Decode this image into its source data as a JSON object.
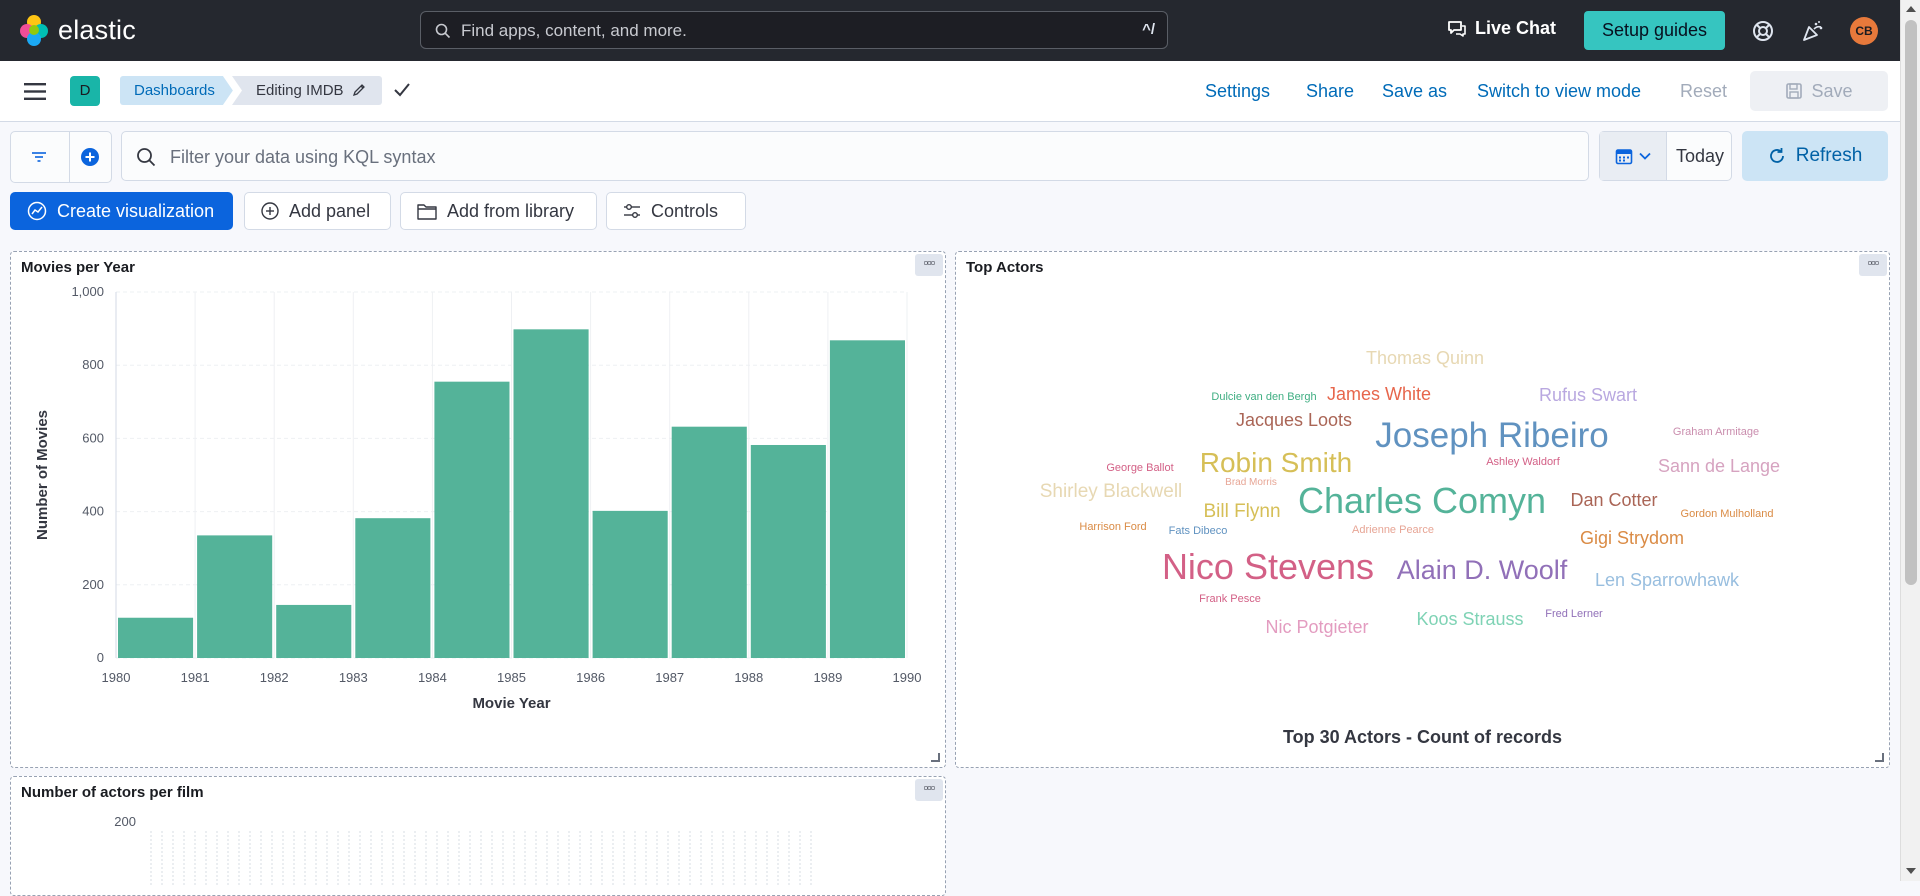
{
  "topbar": {
    "brand": "elastic",
    "search_placeholder": "Find apps, content, and more.",
    "search_shortcut": "^/",
    "live_chat": "Live Chat",
    "setup_guides": "Setup guides",
    "avatar_initials": "CB"
  },
  "navbar": {
    "space_initial": "D",
    "breadcrumbs": [
      "Dashboards",
      "Editing IMDB"
    ],
    "links": [
      "Settings",
      "Share",
      "Save as",
      "Switch to view mode"
    ],
    "reset": "Reset",
    "save": "Save"
  },
  "filterbar": {
    "kql_placeholder": "Filter your data using KQL syntax",
    "date": "Today",
    "refresh": "Refresh"
  },
  "actions": {
    "create_visualization": "Create visualization",
    "add_panel": "Add panel",
    "add_from_library": "Add from library",
    "controls": "Controls"
  },
  "panels": {
    "movies": {
      "title": "Movies per Year",
      "chart_data": {
        "type": "bar",
        "x_edges": [
          1980,
          1981,
          1982,
          1983,
          1984,
          1985,
          1986,
          1987,
          1988,
          1989,
          1990
        ],
        "x_ticks": [
          "1980",
          "1981",
          "1982",
          "1983",
          "1984",
          "1985",
          "1986",
          "1987",
          "1988",
          "1989",
          "1990"
        ],
        "values": [
          110,
          335,
          145,
          382,
          755,
          898,
          402,
          632,
          582,
          868
        ],
        "y_ticks": [
          "0",
          "200",
          "400",
          "600",
          "800",
          "1,000"
        ],
        "ylim": [
          0,
          1000
        ],
        "xlabel": "Movie Year",
        "ylabel": "Number of Movies",
        "color": "#54b399",
        "grid": true
      }
    },
    "actors": {
      "title": "Top Actors",
      "subtitle": "Top 30 Actors - Count of records",
      "words": [
        {
          "text": "Thomas Quinn",
          "color": "#e7d8b3"
        },
        {
          "text": "Dulcie van den Bergh",
          "color": "#3fae82"
        },
        {
          "text": "James White",
          "color": "#e7664c"
        },
        {
          "text": "Rufus Swart",
          "color": "#b9a8e0"
        },
        {
          "text": "Jacques Loots",
          "color": "#aa6556"
        },
        {
          "text": "Joseph Ribeiro",
          "color": "#6092c0"
        },
        {
          "text": "Graham Armitage",
          "color": "#ca8eae"
        },
        {
          "text": "Robin Smith",
          "color": "#d6bf57"
        },
        {
          "text": "George Ballot",
          "color": "#d36086"
        },
        {
          "text": "Ashley Waldorf",
          "color": "#d36086"
        },
        {
          "text": "Sann de Lange",
          "color": "#d6a3c0"
        },
        {
          "text": "Brad Morris",
          "color": "#e7a595"
        },
        {
          "text": "Shirley Blackwell",
          "color": "#e7d8b3"
        },
        {
          "text": "Charles Comyn",
          "color": "#54b399"
        },
        {
          "text": "Dan Cotter",
          "color": "#aa6556"
        },
        {
          "text": "Bill Flynn",
          "color": "#d6bf57"
        },
        {
          "text": "Gordon Mulholland",
          "color": "#da8b45"
        },
        {
          "text": "Harrison Ford",
          "color": "#da8b45"
        },
        {
          "text": "Fats Dibeco",
          "color": "#6092c0"
        },
        {
          "text": "Adrienne Pearce",
          "color": "#e7a595"
        },
        {
          "text": "Gigi Strydom",
          "color": "#da8b45"
        },
        {
          "text": "Nico Stevens",
          "color": "#d36086"
        },
        {
          "text": "Alain D. Woolf",
          "color": "#9170b8"
        },
        {
          "text": "Len Sparrowhawk",
          "color": "#98bedf"
        },
        {
          "text": "Frank Pesce",
          "color": "#d36086"
        },
        {
          "text": "Fred Lerner",
          "color": "#9170b8"
        },
        {
          "text": "Koos Strauss",
          "color": "#7fd3b5"
        },
        {
          "text": "Nic Potgieter",
          "color": "#e39cc0"
        }
      ]
    },
    "actors_per_film": {
      "title": "Number of actors per film",
      "y_tick": "200"
    }
  }
}
